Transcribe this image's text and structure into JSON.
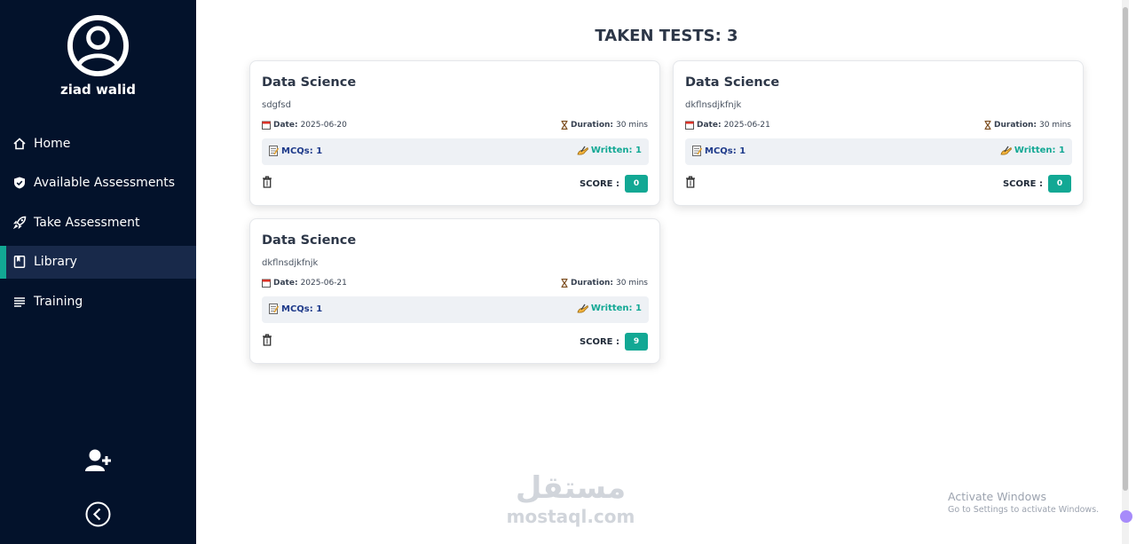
{
  "user": {
    "name": "ziad walid"
  },
  "nav": {
    "items": [
      {
        "label": "Home",
        "icon": "home-icon",
        "active": false
      },
      {
        "label": "Available Assessments",
        "icon": "shield-check-icon",
        "active": false
      },
      {
        "label": "Take Assessment",
        "icon": "rocket-icon",
        "active": false
      },
      {
        "label": "Library",
        "icon": "book-icon",
        "active": true
      },
      {
        "label": "Training",
        "icon": "list-lines-icon",
        "active": false
      }
    ]
  },
  "page": {
    "title": "TAKEN TESTS: 3"
  },
  "cards": [
    {
      "title": "Data Science",
      "description": "sdgfsd",
      "date_label": "Date:",
      "date": "2025-06-20",
      "duration_label": "Duration:",
      "duration": "30 mins",
      "mcqs": "MCQs: 1",
      "written": "Written: 1",
      "score_label": "SCORE :",
      "score": "0"
    },
    {
      "title": "Data Science",
      "description": "dkflnsdjkfnjk",
      "date_label": "Date:",
      "date": "2025-06-21",
      "duration_label": "Duration:",
      "duration": "30 mins",
      "mcqs": "MCQs: 1",
      "written": "Written: 1",
      "score_label": "SCORE :",
      "score": "0"
    },
    {
      "title": "Data Science",
      "description": "dkflnsdjkfnjk",
      "date_label": "Date:",
      "date": "2025-06-21",
      "duration_label": "Duration:",
      "duration": "30 mins",
      "mcqs": "MCQs: 1",
      "written": "Written: 1",
      "score_label": "SCORE :",
      "score": "9"
    }
  ],
  "watermark": {
    "arabic": "مستقل",
    "latin": "mostaql.com"
  },
  "windows_notice": {
    "title": "Activate Windows",
    "subtitle": "Go to Settings to activate Windows."
  },
  "colors": {
    "sidebar": "#03122b",
    "accent": "#12a894",
    "active_item": "#18294a",
    "mcq_text": "#1e3a8a"
  }
}
